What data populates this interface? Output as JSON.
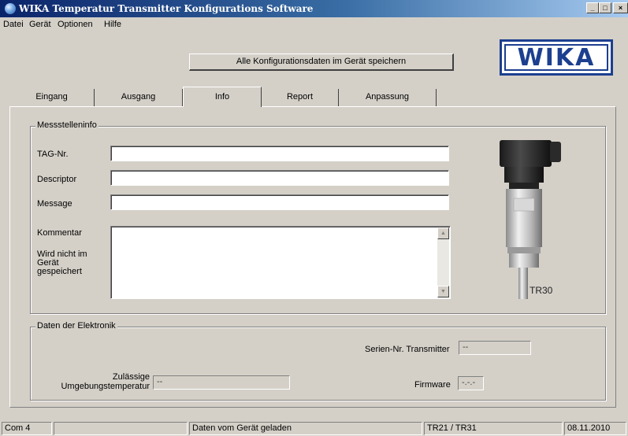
{
  "window": {
    "title": "WIKA Temperatur Transmitter Konfigurations Software",
    "controls": {
      "minimize": "_",
      "maximize": "□",
      "close": "×"
    }
  },
  "menu": {
    "items": [
      "Datei",
      "Gerät",
      "Optionen",
      "Hilfe"
    ]
  },
  "toolbar": {
    "save_all_label": "Alle Konfigurationsdaten im Gerät speichern"
  },
  "logo": {
    "text": "WIKA",
    "color": "#1c3f8f"
  },
  "tabs": [
    {
      "label": "Eingang",
      "active": false
    },
    {
      "label": "Ausgang",
      "active": false
    },
    {
      "label": "Info",
      "active": true
    },
    {
      "label": "Report",
      "active": false
    },
    {
      "label": "Anpassung",
      "active": false
    }
  ],
  "info": {
    "messstelle": {
      "title": "Messstelleninfo",
      "tag_label": "TAG-Nr.",
      "tag_value": "",
      "descriptor_label": "Descriptor",
      "descriptor_value": "",
      "message_label": "Message",
      "message_value": "",
      "kommentar_label": "Kommentar",
      "kommentar_note": "Wird nicht im Gerät gespeichert",
      "kommentar_value": ""
    },
    "device_model": "TR30",
    "elektronik": {
      "title": "Daten der Elektronik",
      "serial_label": "Serien-Nr. Transmitter",
      "serial_value": "--",
      "ambient_label": "Zulässige Umgebungstemperatur",
      "ambient_value": "--",
      "firmware_label": "Firmware",
      "firmware_value": "-.-.-"
    }
  },
  "status": {
    "port": "Com 4",
    "empty": "",
    "message": "Daten vom Gerät geladen",
    "device": "TR21 / TR31",
    "date": "08.11.2010"
  }
}
